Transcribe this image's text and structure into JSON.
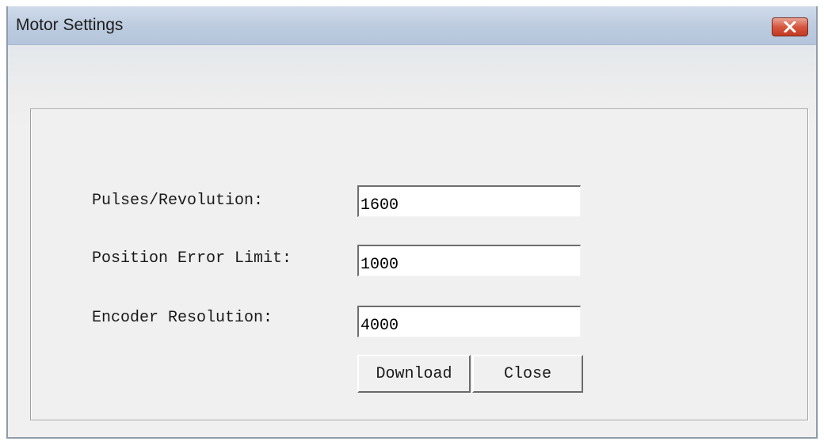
{
  "window": {
    "title": "Motor Settings",
    "close_icon": "close-x-icon",
    "accent_close": "#c9452d"
  },
  "form": {
    "fields": [
      {
        "label": "Pulses/Revolution:",
        "value": "1600"
      },
      {
        "label": "Position Error Limit:",
        "value": "1000"
      },
      {
        "label": "Encoder Resolution:",
        "value": "4000"
      }
    ]
  },
  "buttons": {
    "download_label": "Download",
    "close_label": "Close"
  }
}
